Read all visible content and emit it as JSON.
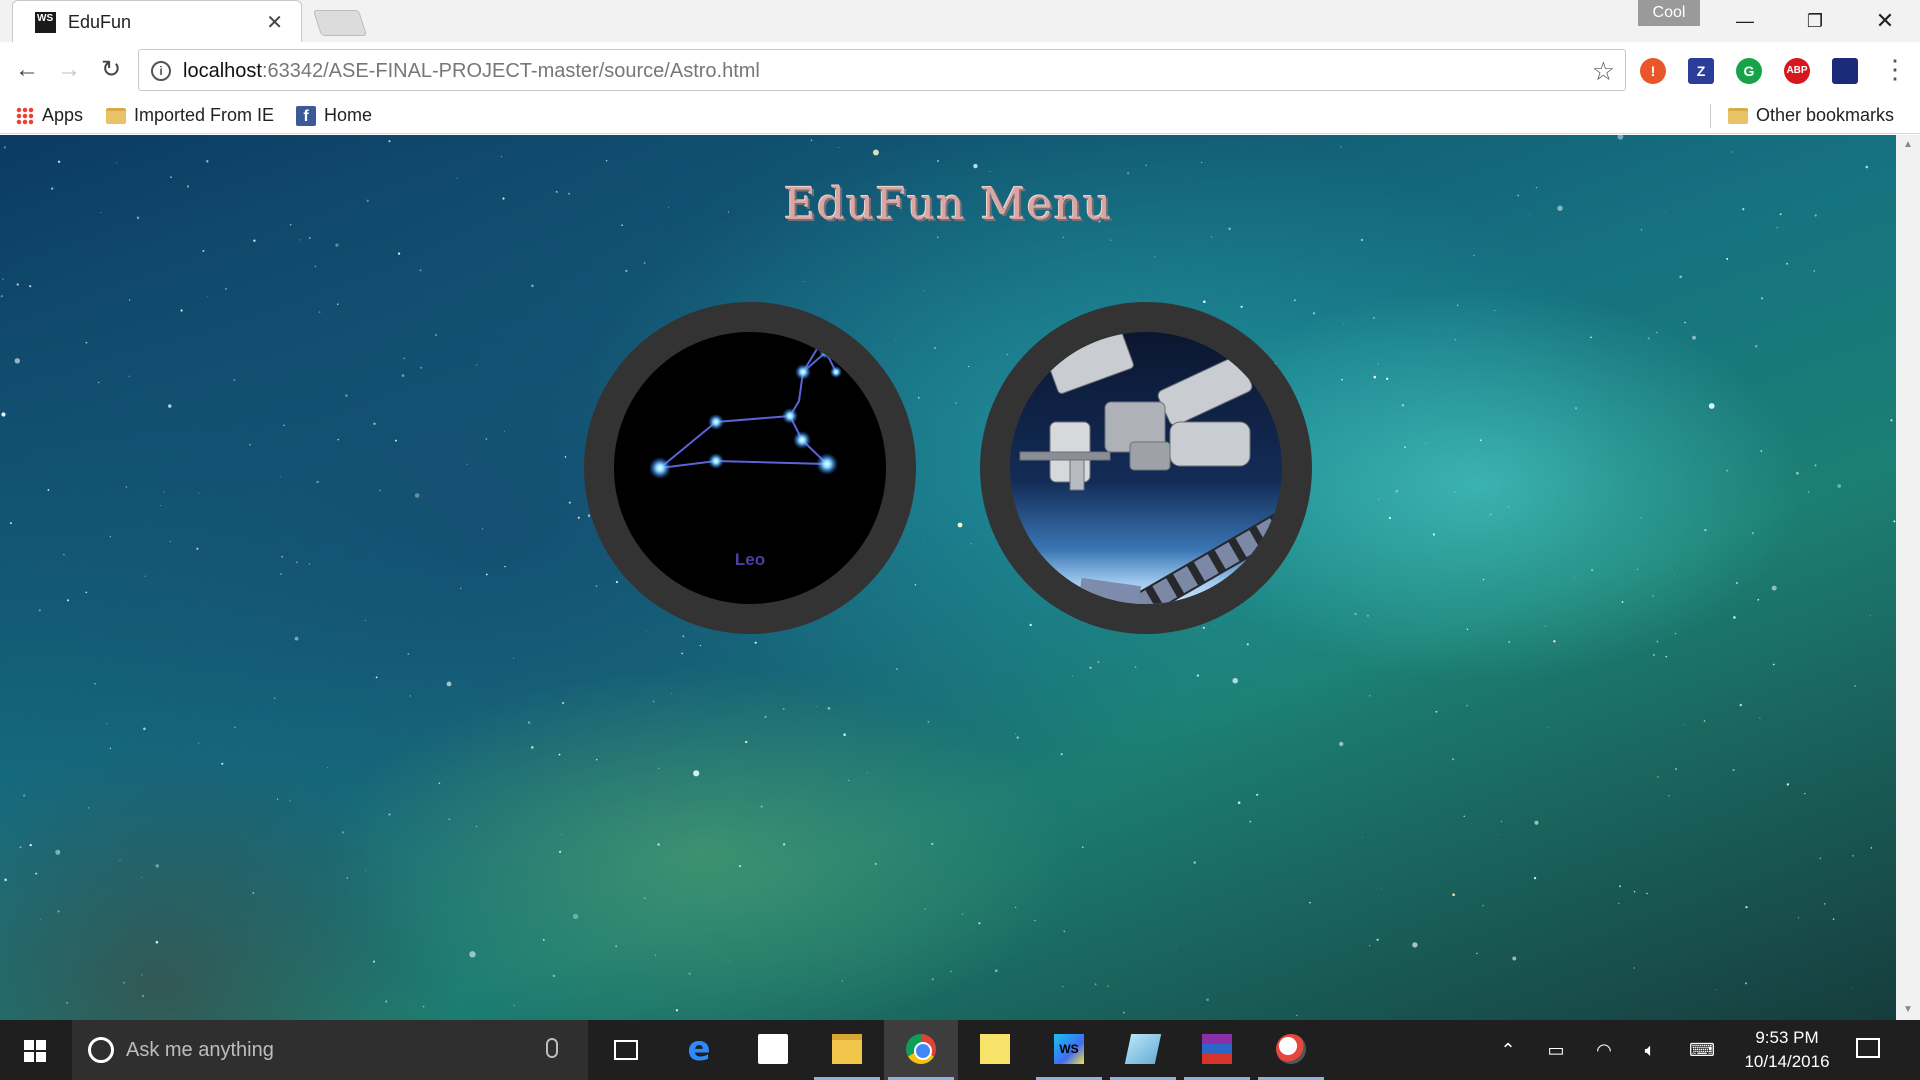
{
  "browser": {
    "tab_title": "EduFun",
    "tab_favicon_text": "WS",
    "profile_label": "Cool",
    "url_host": "localhost",
    "url_rest": ":63342/ASE-FINAL-PROJECT-master/source/Astro.html",
    "extensions": [
      "!",
      "Z",
      "G",
      "ABP",
      ""
    ],
    "bookmarks": {
      "apps": "Apps",
      "imported": "Imported From IE",
      "home": "Home",
      "other": "Other bookmarks"
    }
  },
  "page": {
    "title": "EduFun Menu",
    "items": [
      {
        "label": "Leo",
        "image": "constellation-leo"
      },
      {
        "label": "",
        "image": "space-station"
      }
    ]
  },
  "taskbar": {
    "search_placeholder": "Ask me anything",
    "time": "9:53 PM",
    "date": "10/14/2016",
    "apps": [
      "task-view",
      "edge",
      "store",
      "file-explorer",
      "chrome",
      "sticky-notes",
      "webstorm",
      "notepad",
      "winrar",
      "snipping-tool"
    ]
  },
  "colors": {
    "title_text": "#d9a6a3",
    "circle_ring": "#333333",
    "leo_label": "#4b3fa0",
    "taskbar": "#1f1f1f"
  }
}
